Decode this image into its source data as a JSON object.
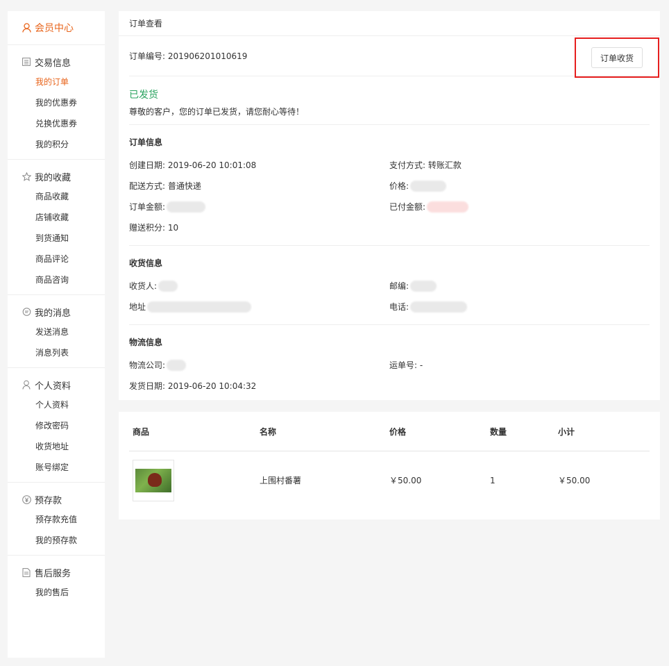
{
  "sidebar": {
    "header": "会员中心",
    "groups": [
      {
        "title": "交易信息",
        "icon": "list-icon",
        "items": [
          "我的订单",
          "我的优惠券",
          "兑换优惠券",
          "我的积分"
        ]
      },
      {
        "title": "我的收藏",
        "icon": "star-icon",
        "items": [
          "商品收藏",
          "店铺收藏",
          "到货通知",
          "商品评论",
          "商品咨询"
        ]
      },
      {
        "title": "我的消息",
        "icon": "chat-icon",
        "items": [
          "发送消息",
          "消息列表"
        ]
      },
      {
        "title": "个人资料",
        "icon": "user-icon",
        "items": [
          "个人资料",
          "修改密码",
          "收货地址",
          "账号绑定"
        ]
      },
      {
        "title": "预存款",
        "icon": "yen-icon",
        "items": [
          "预存款充值",
          "我的预存款"
        ]
      },
      {
        "title": "售后服务",
        "icon": "document-icon",
        "items": [
          "我的售后"
        ]
      }
    ]
  },
  "order": {
    "panel_title": "订单查看",
    "order_no_label": "订单编号: ",
    "order_no": "201906201010619",
    "receive_button": "订单收货",
    "status": "已发货",
    "status_message": "尊敬的客户，您的订单已发货，请您耐心等待！",
    "info_title": "订单信息",
    "create_date": "创建日期: 2019-06-20 10:01:08",
    "pay_method": "支付方式: 转账汇款",
    "ship_method": "配送方式: 普通快递",
    "price_label": "价格: ",
    "amount_label": "订单金额: ",
    "paid_label": "已付金额: ",
    "points": "赠送积分: 10",
    "receiver_title": "收货信息",
    "receiver_label": "收货人:",
    "zip_label": "邮编: ",
    "address_label": "地址",
    "phone_label": "电话: ",
    "logistics_title": "物流信息",
    "logistics_company_label": "物流公司: ",
    "tracking_no": "运单号: -",
    "ship_date": "发货日期: 2019-06-20 10:04:32"
  },
  "items_table": {
    "headers": [
      "商品",
      "名称",
      "价格",
      "数量",
      "小计"
    ],
    "rows": [
      {
        "name": "上围村番薯",
        "price": "￥50.00",
        "qty": "1",
        "subtotal": "￥50.00"
      }
    ]
  },
  "colors": {
    "accent": "#e8641b",
    "status_green": "#2aa35f",
    "highlight_red": "#e61e1e"
  }
}
